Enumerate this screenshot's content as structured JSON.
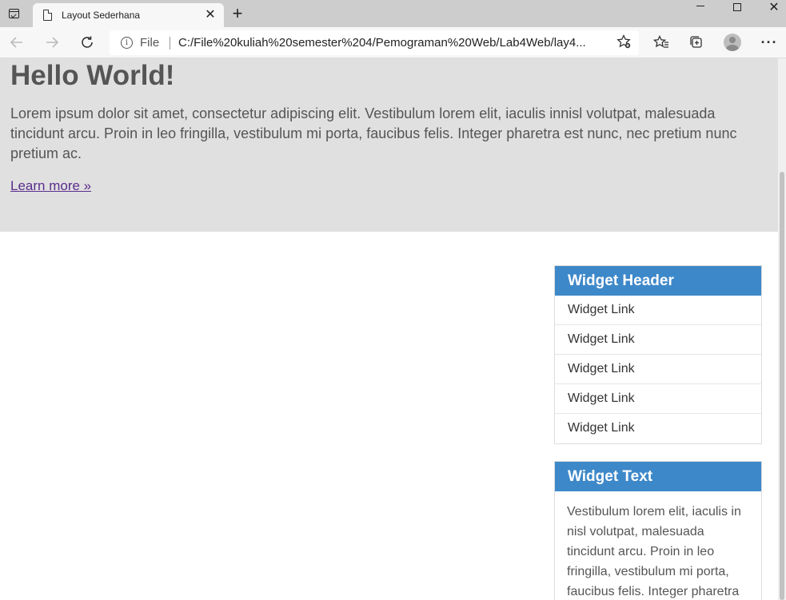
{
  "browser": {
    "tab_title": "Layout Sederhana",
    "tab_close": "✕",
    "new_tab": "+",
    "file_label": "File",
    "url": "C:/File%20kuliah%20semester%204/Pemograman%20Web/Lab4Web/lay4...",
    "window_close": "✕"
  },
  "hero": {
    "heading": "Hello World!",
    "paragraph": "Lorem ipsum dolor sit amet, consectetur adipiscing elit. Vestibulum lorem elit, iaculis innisl volutpat, malesuada tincidunt arcu. Proin in leo fringilla, vestibulum mi porta, faucibus felis. Integer pharetra est nunc, nec pretium nunc pretium ac.",
    "link": "Learn more »"
  },
  "widget_links": {
    "header": "Widget Header",
    "items": [
      "Widget Link",
      "Widget Link",
      "Widget Link",
      "Widget Link",
      "Widget Link"
    ]
  },
  "widget_text": {
    "header": "Widget Text",
    "body": "Vestibulum lorem elit, iaculis in nisl volutpat, malesuada tincidunt arcu. Proin in leo fringilla, vestibulum mi porta, faucibus felis. Integer pharetra"
  },
  "colors": {
    "widget_header_bg": "#3d88c9",
    "hero_bg": "#e0e0e0",
    "link_color": "#5a2d8c"
  },
  "icons": [
    "window-menu-icon",
    "page-icon",
    "back-arrow-icon",
    "forward-arrow-icon",
    "reload-icon",
    "info-icon",
    "add-favorite-icon",
    "favorites-icon",
    "collections-icon",
    "profile-icon",
    "more-icon"
  ]
}
